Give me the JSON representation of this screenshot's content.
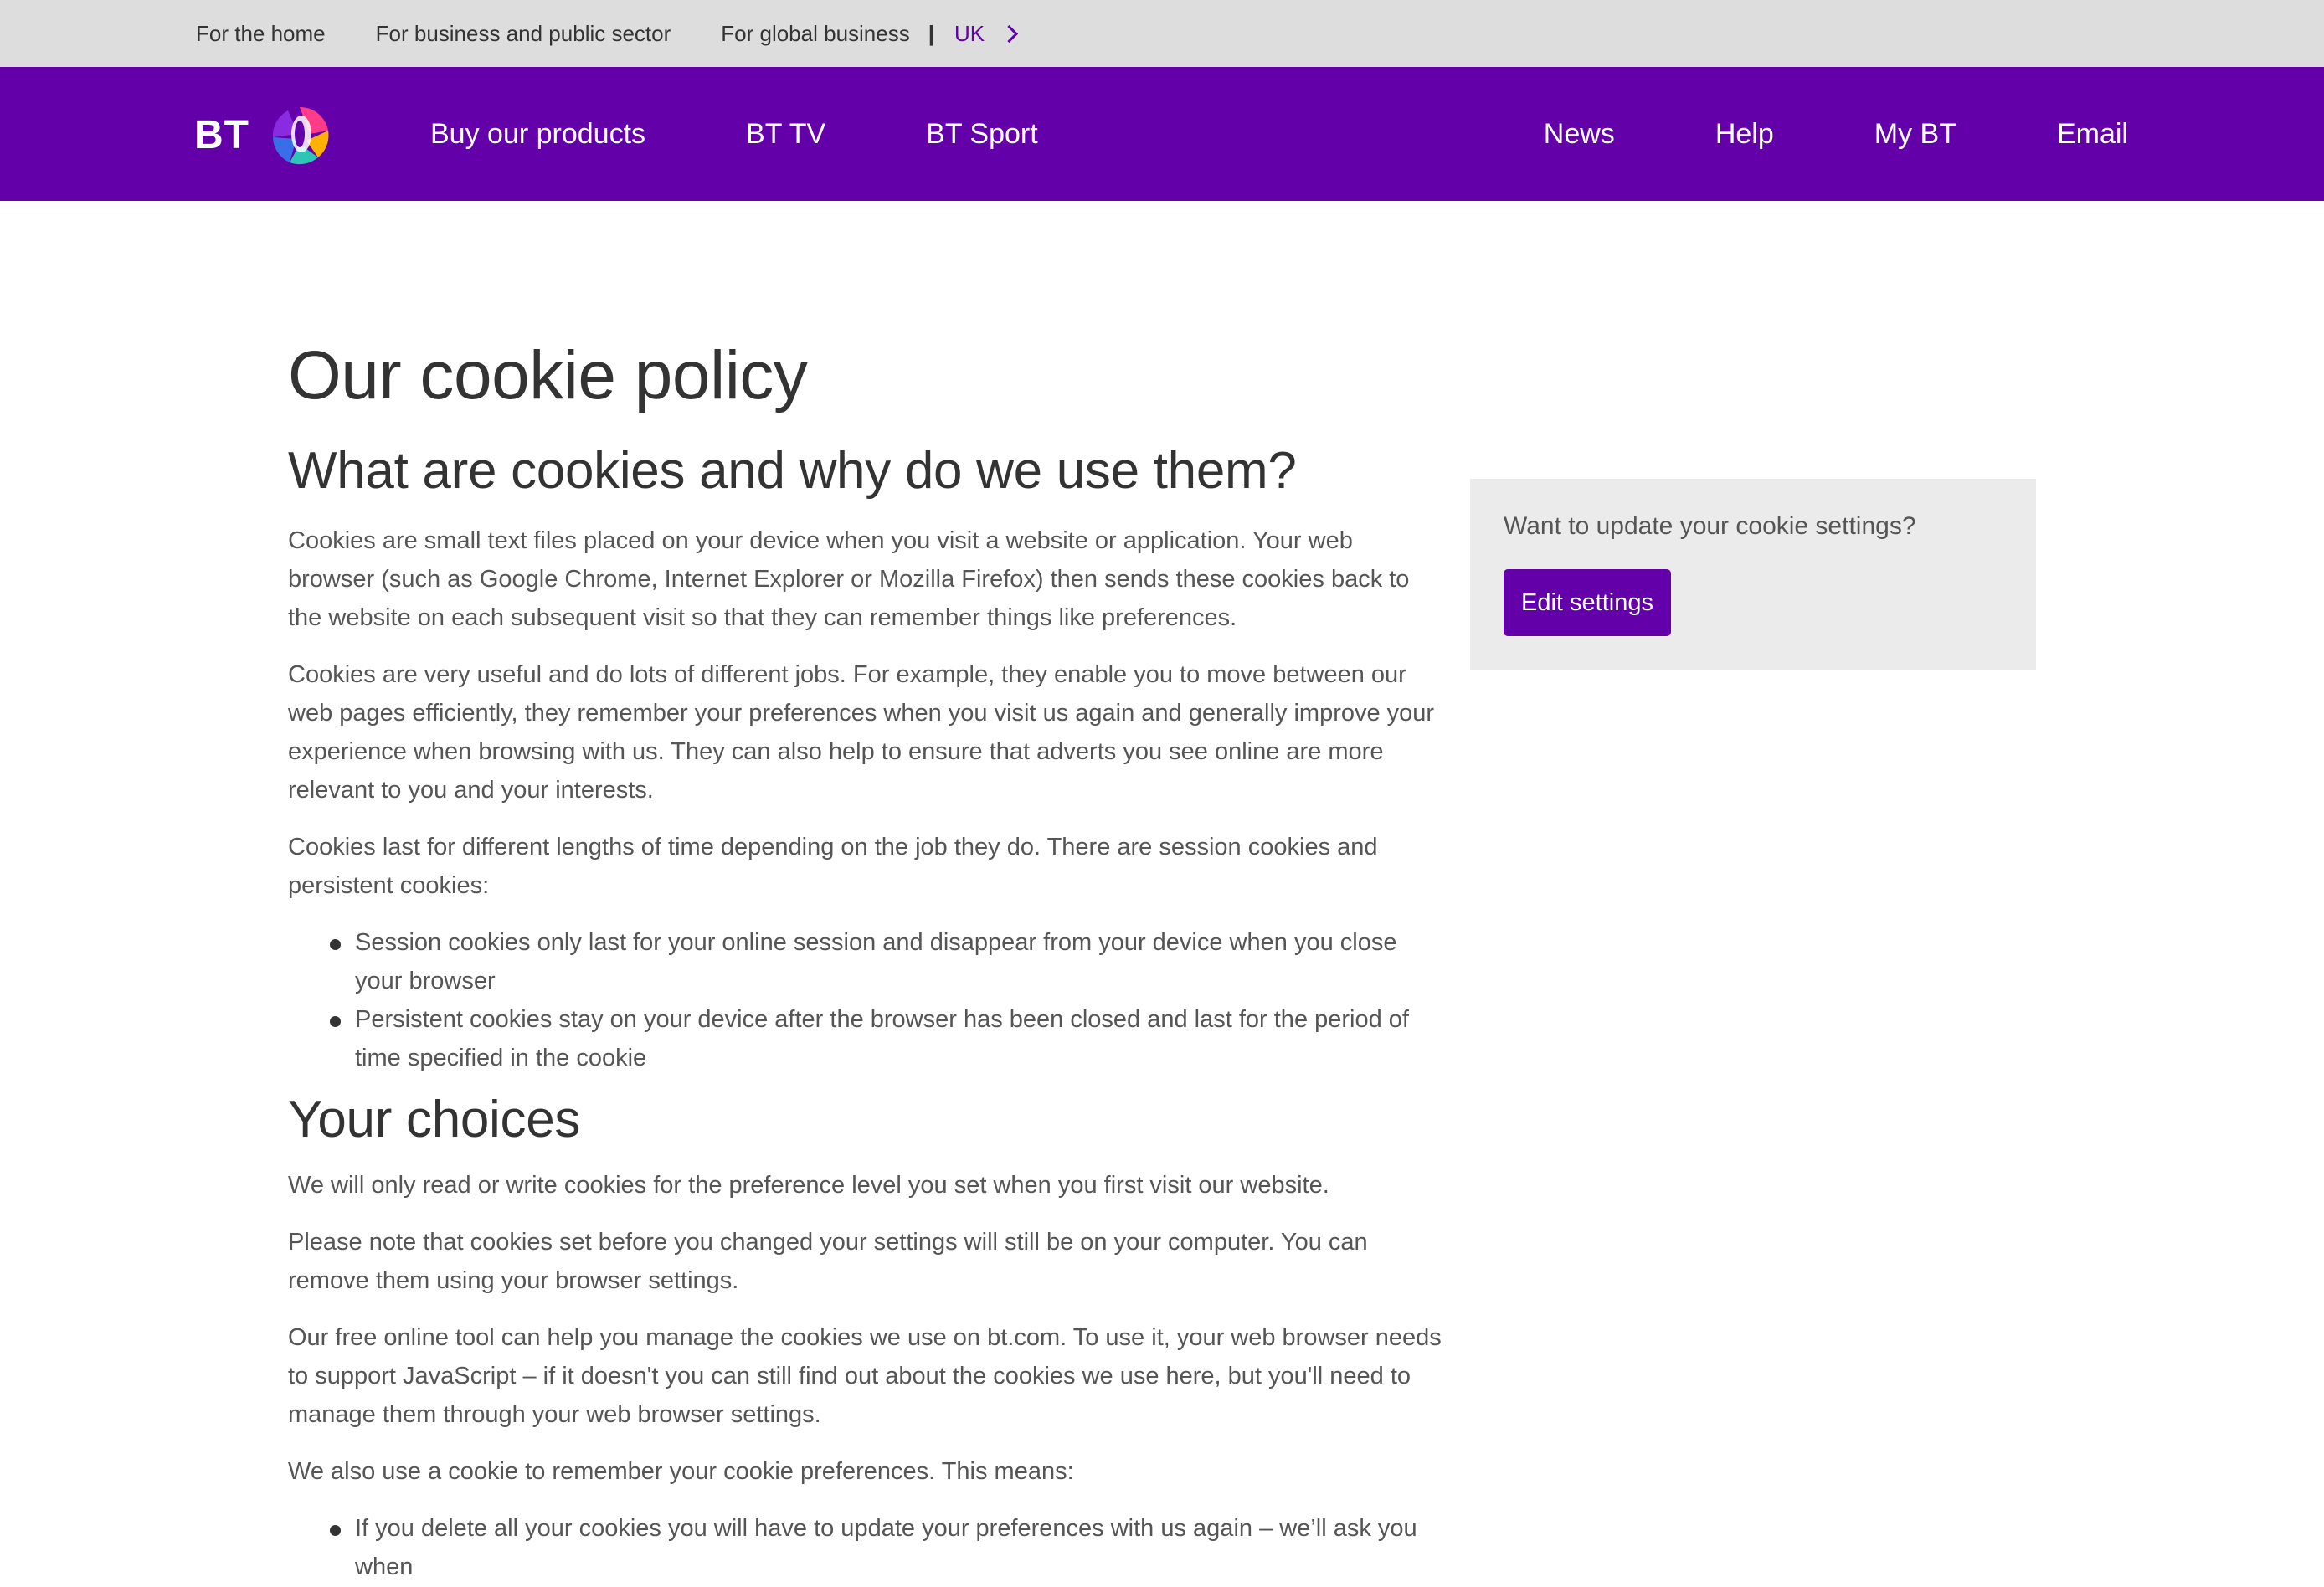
{
  "topbar": {
    "links": [
      "For the home",
      "For business and public sector",
      "For global business"
    ],
    "separator": "|",
    "region": "UK"
  },
  "navbar": {
    "logo_text": "BT",
    "left_items": [
      "Buy our products",
      "BT TV",
      "BT Sport"
    ],
    "right_items": [
      "News",
      "Help",
      "My BT",
      "Email"
    ]
  },
  "main": {
    "title": "Our cookie policy",
    "section1": {
      "heading": "What are cookies and why do we use them?",
      "paragraphs": [
        "Cookies are small text files placed on your device when you visit a website or application. Your web browser (such as Google Chrome, Internet Explorer or Mozilla Firefox) then sends these cookies back to the website on each subsequent visit so that they can remember things like preferences.",
        "Cookies are very useful and do lots of different jobs. For example, they enable you to move between our web pages efficiently, they remember your preferences when you visit us again and generally improve your experience when browsing with us. They can also help to ensure that adverts you see online are more relevant to you and your interests.",
        "Cookies last for different lengths of time depending on the job they do. There are session cookies and persistent cookies:"
      ],
      "bullets": [
        "Session cookies only last for your online session and disappear from your device when you close your browser",
        "Persistent cookies stay on your device after the browser has been closed and last for the period of time specified in the cookie"
      ]
    },
    "section2": {
      "heading": "Your choices",
      "paragraphs": [
        "We will only read or write cookies for the preference level you set when you first visit our website.",
        "Please note that cookies set before you changed your settings will still be on your computer. You can remove them using your browser settings.",
        "Our free online tool can help you manage the cookies we use on bt.com. To use it, your web browser needs to support JavaScript – if it doesn't you can still find out about the cookies we use here, but you'll need to manage them through your web browser settings.",
        "We also use a cookie to remember your cookie preferences. This means:"
      ],
      "bullets": [
        "If you delete all your cookies you will have to update your preferences with us again – we’ll ask you when"
      ]
    }
  },
  "sidebar": {
    "prompt": "Want to update your cookie settings?",
    "button_label": "Edit settings"
  },
  "colors": {
    "brand_purple": "#6400aa",
    "topbar_bg": "#dddddd",
    "panel_bg": "#ebebeb"
  }
}
